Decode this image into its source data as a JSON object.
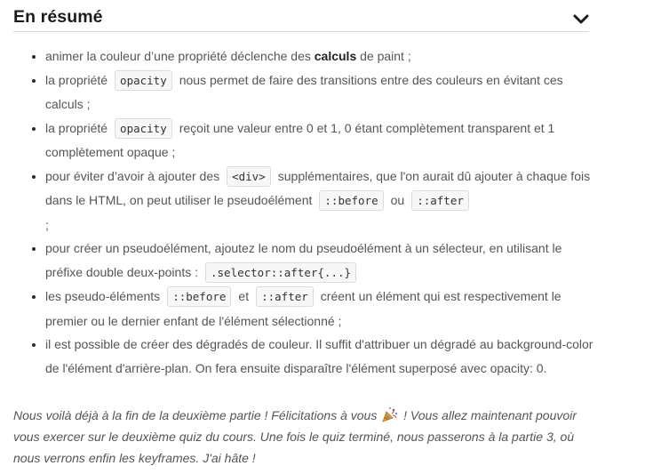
{
  "summary": {
    "title": "En résumé"
  },
  "items": [
    {
      "t1": "animer la couleur d’une propriété déclenche des ",
      "bold": "calculs",
      "t2": " de paint ;"
    },
    {
      "t1": "la propriété",
      "code": "opacity",
      "t2": "nous permet de faire des transitions entre des couleurs en évitant ces calculs ;"
    },
    {
      "t1": "la propriété",
      "code": "opacity",
      "t2": "reçoit une valeur entre 0 et 1, 0 étant complètement transparent et 1 complètement opaque ;"
    },
    {
      "t1": "pour éviter d’avoir à ajouter des",
      "code1": "<div>",
      "t2": "supplémentaires, que l'on aurait dû ajouter à chaque fois dans le HTML, on peut utiliser le pseudoélément",
      "code2": "::before",
      "t3": "ou",
      "code3": "::after",
      "t4": ";"
    },
    {
      "t1": "pour créer un pseudoélément, ajoutez le nom du pseudoélément à un sélecteur, en utilisant le préfixe double deux-points :",
      "code": ".selector::after{...}"
    },
    {
      "t1": "les pseudo-éléments",
      "code1": "::before",
      "t2": "et",
      "code2": "::after",
      "t3": "créent un élément qui est respectivement le premier ou le dernier enfant de l'élément sélectionné ;"
    },
    {
      "t1": "il est possible de créer des dégradés de couleur. Il suffit d'attribuer un dégradé au background-color de l'élément d'arrière-plan. On fera ensuite disparaître l'élément superposé avec opacity: 0."
    }
  ],
  "outro": {
    "t1": "Nous voilà déjà à la fin de la deuxième partie ! Félicitations à vous",
    "icon": "party-popper-icon",
    "t2": "! Vous allez maintenant pouvoir vous exercer sur le deuxième quiz du cours. Une fois le quiz terminé, nous passerons à la partie 3, où nous verrons enfin les keyframes. J'ai hâte !"
  },
  "colors": {
    "title": "#1b1b1b",
    "body_text": "#555555",
    "code_bg": "#f7f7f7",
    "code_border": "#dcdcdc"
  }
}
